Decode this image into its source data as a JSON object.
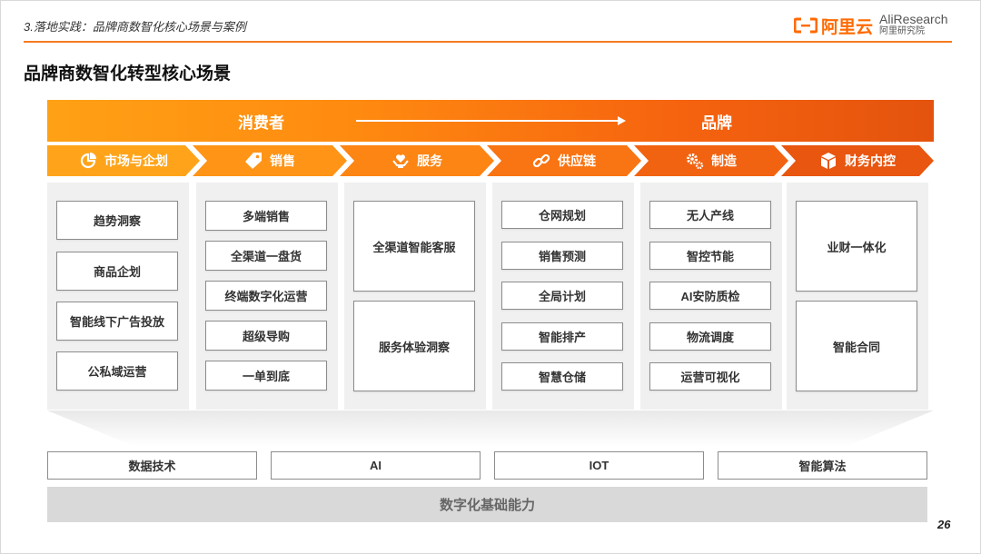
{
  "header": {
    "section_label": "3.落地实践：品牌商数智化核心场景与案例",
    "logo_aliyun": "阿里云",
    "logo_aliresearch_top": "AliResearch",
    "logo_aliresearch_bottom": "阿里研究院"
  },
  "page_title": "品牌商数智化转型核心场景",
  "banner": {
    "left_label": "消费者",
    "right_label": "品牌"
  },
  "stages": [
    {
      "label": "市场与企划",
      "icon": "pie-chart-icon",
      "color": "#ffa41a"
    },
    {
      "label": "销售",
      "icon": "price-tag-icon",
      "color": "#ff9416"
    },
    {
      "label": "服务",
      "icon": "heart-hand-icon",
      "color": "#fd8514"
    },
    {
      "label": "供应链",
      "icon": "chain-link-icon",
      "color": "#f97412"
    },
    {
      "label": "制造",
      "icon": "gears-icon",
      "color": "#f16311"
    },
    {
      "label": "财务内控",
      "icon": "box-icon",
      "color": "#e8560f"
    }
  ],
  "columns": [
    {
      "items": [
        "趋势洞察",
        "商品企划",
        "智能线下广告投放",
        "公私域运营"
      ]
    },
    {
      "items": [
        "多端销售",
        "全渠道一盘货",
        "终端数字化运营",
        "超级导购",
        "一单到底"
      ]
    },
    {
      "items": [
        "全渠道智能客服",
        "服务体验洞察"
      ]
    },
    {
      "items": [
        "仓网规划",
        "销售预测",
        "全局计划",
        "智能排产",
        "智慧仓储"
      ]
    },
    {
      "items": [
        "无人产线",
        "智控节能",
        "AI安防质检",
        "物流调度",
        "运营可视化"
      ]
    },
    {
      "items": [
        "业财一体化",
        "智能合同"
      ]
    }
  ],
  "foundation": {
    "technologies": [
      "数据技术",
      "AI",
      "IOT",
      "智能算法"
    ],
    "base_label": "数字化基础能力"
  },
  "page_number": "26",
  "colors": {
    "accent": "#f57c1f",
    "brand_orange": "#ff6a00"
  }
}
